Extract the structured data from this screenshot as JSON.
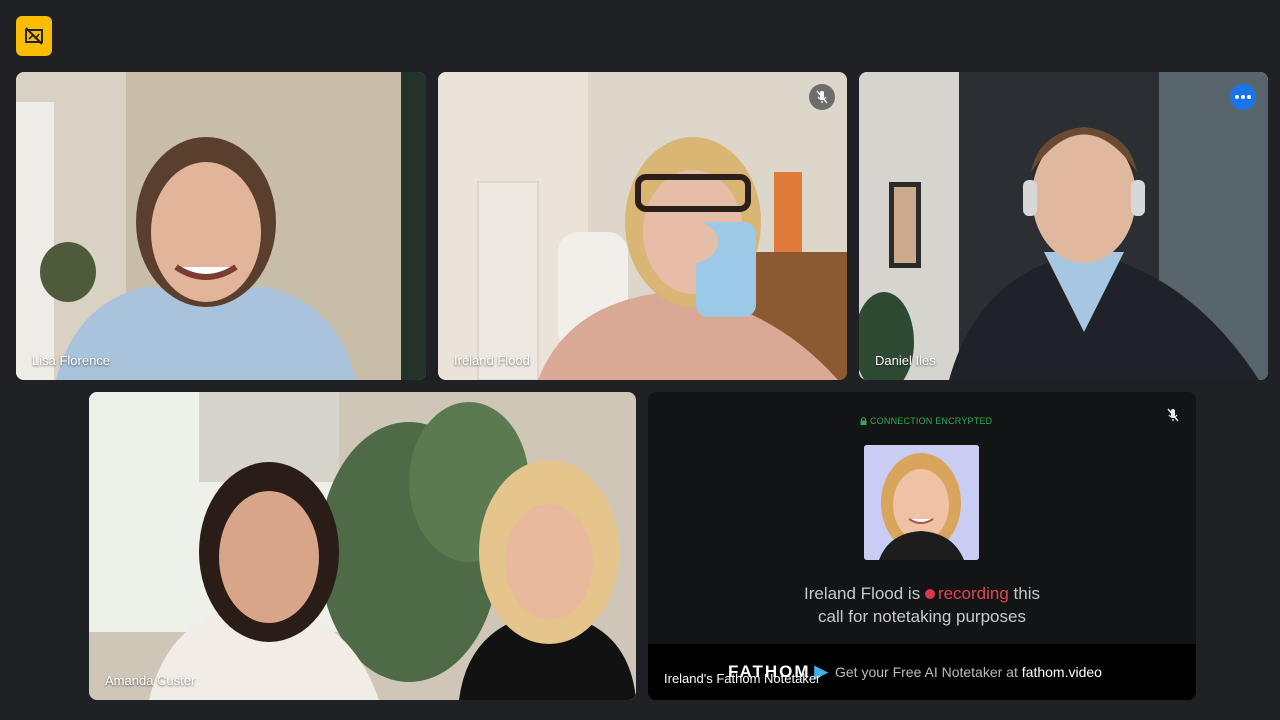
{
  "toolbar": {
    "badge_icon": "screen-share-off-icon",
    "badge_color": "#fbbc04"
  },
  "participants": [
    {
      "name": "Lisa Florence",
      "muted": false
    },
    {
      "name": "Ireland Flood",
      "muted": true
    },
    {
      "name": "Daniel Iles",
      "muted": false,
      "speaking": true
    },
    {
      "name": "Amanda Custer",
      "muted": false
    }
  ],
  "notetaker": {
    "name": "Ireland's Fathom Notetaker",
    "encryption_label": "CONNECTION ENCRYPTED",
    "message_before": "Ireland Flood is ",
    "message_recording": "recording",
    "message_after": " this",
    "message_line2": "call for notetaking purposes",
    "brand": "FATHOM",
    "promo_text": "Get your Free AI Notetaker at ",
    "promo_link": "fathom.video"
  },
  "colors": {
    "accent": "#8ab4f8",
    "recording": "#e0454f",
    "encrypted": "#34a853"
  }
}
